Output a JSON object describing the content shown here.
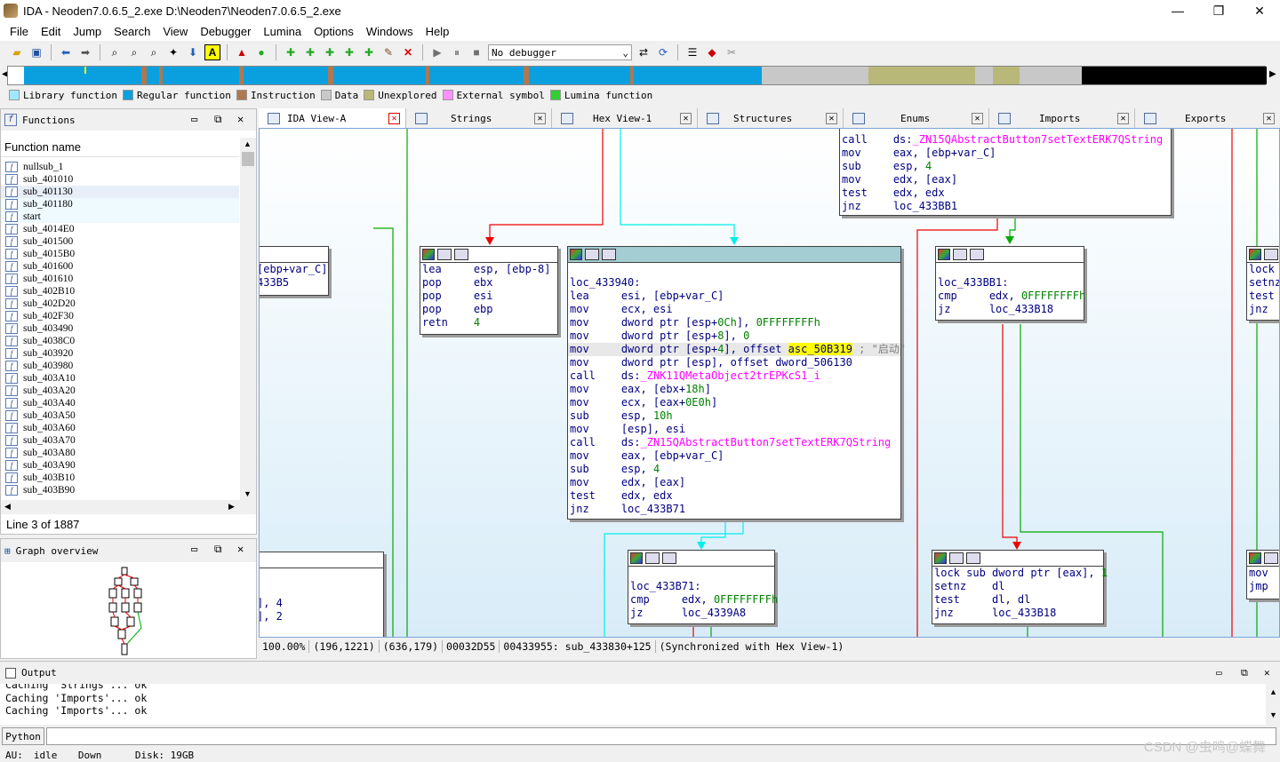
{
  "window": {
    "title": "IDA - Neoden7.0.6.5_2.exe D:\\Neoden7\\Neoden7.0.6.5_2.exe",
    "controls": [
      "—",
      "❐",
      "✕"
    ]
  },
  "menu": [
    "File",
    "Edit",
    "Jump",
    "Search",
    "View",
    "Debugger",
    "Lumina",
    "Options",
    "Windows",
    "Help"
  ],
  "toolbar": {
    "debugger_select": "No debugger"
  },
  "legend": [
    {
      "label": "Library function",
      "color": "#a0e8ff"
    },
    {
      "label": "Regular function",
      "color": "#0aa0e0"
    },
    {
      "label": "Instruction",
      "color": "#b07850"
    },
    {
      "label": "Data",
      "color": "#c8c8c8"
    },
    {
      "label": "Unexplored",
      "color": "#b8b878"
    },
    {
      "label": "External symbol",
      "color": "#ff90ff"
    },
    {
      "label": "Lumina function",
      "color": "#30d030"
    }
  ],
  "functions_panel": {
    "title": "Functions",
    "column": "Function name",
    "items": [
      "nullsub_1",
      "sub_401010",
      "sub_401130",
      "sub_401180",
      "start",
      "sub_4014E0",
      "sub_401500",
      "sub_4015B0",
      "sub_401600",
      "sub_401610",
      "sub_402B10",
      "sub_402D20",
      "sub_402F30",
      "sub_403490",
      "sub_4038C0",
      "sub_403920",
      "sub_403980",
      "sub_403A10",
      "sub_403A20",
      "sub_403A40",
      "sub_403A50",
      "sub_403A60",
      "sub_403A70",
      "sub_403A80",
      "sub_403A90",
      "sub_403B10",
      "sub_403B90"
    ],
    "line_status": "Line 3 of 1887"
  },
  "graph_overview": {
    "title": "Graph overview"
  },
  "tabs": [
    {
      "label": "IDA View-A"
    },
    {
      "label": "Strings"
    },
    {
      "label": "Hex View-1"
    },
    {
      "label": "Structures"
    },
    {
      "label": "Enums"
    },
    {
      "label": "Imports"
    },
    {
      "label": "Exports"
    }
  ],
  "blocks": {
    "top_right": {
      "lines": [
        {
          "m": "call",
          "o": "ds:",
          "s": "_ZN15QAbstractButton7setTextERK7QString"
        },
        {
          "m": "mov",
          "o": "eax, [ebp+var_C]"
        },
        {
          "m": "sub",
          "o": "esp, ",
          "n": "4"
        },
        {
          "m": "mov",
          "o": "edx, [eax]"
        },
        {
          "m": "test",
          "o": "edx, edx"
        },
        {
          "m": "jnz",
          "o": "loc_433BB1"
        }
      ]
    },
    "left_partial": {
      "lines": [
        "[ebp+var_C]",
        "433B5"
      ]
    },
    "epilogue": {
      "lines": [
        {
          "m": "lea",
          "o": "esp, [ebp-8]"
        },
        {
          "m": "pop",
          "o": "ebx"
        },
        {
          "m": "pop",
          "o": "esi"
        },
        {
          "m": "pop",
          "o": "ebp"
        },
        {
          "m": "retn",
          "n": "4"
        }
      ]
    },
    "main": {
      "label": "loc_433940:",
      "lines": [
        {
          "m": "lea",
          "o": "esi, [ebp+var_C]"
        },
        {
          "m": "mov",
          "o": "ecx, esi"
        },
        {
          "m": "mov",
          "o": "dword ptr [esp+",
          "n": "0Ch",
          "o2": "], ",
          "n2": "0FFFFFFFFh"
        },
        {
          "m": "mov",
          "o": "dword ptr [esp+",
          "n": "8",
          "o2": "], ",
          "n2": "0"
        },
        {
          "m": "mov",
          "o": "dword ptr [esp+",
          "n": "4",
          "o2": "], offset ",
          "h": "asc_50B319",
          "c": " ; \"启动\""
        },
        {
          "m": "mov",
          "o": "dword ptr [esp], offset dword_506130"
        },
        {
          "m": "call",
          "o": "ds:",
          "s": "_ZNK11QMetaObject2trEPKcS1_i"
        },
        {
          "m": "mov",
          "o": "eax, [ebx+",
          "n": "18h",
          "o2": "]"
        },
        {
          "m": "mov",
          "o": "ecx, [eax+",
          "n": "0E0h",
          "o2": "]"
        },
        {
          "m": "sub",
          "o": "esp, ",
          "n": "10h"
        },
        {
          "m": "mov",
          "o": "[esp], esi"
        },
        {
          "m": "call",
          "o": "ds:",
          "s": "_ZN15QAbstractButton7setTextERK7QString"
        },
        {
          "m": "mov",
          "o": "eax, [ebp+var_C]"
        },
        {
          "m": "sub",
          "o": "esp, ",
          "n": "4"
        },
        {
          "m": "mov",
          "o": "edx, [eax]"
        },
        {
          "m": "test",
          "o": "edx, edx"
        },
        {
          "m": "jnz",
          "o": "loc_433B71"
        }
      ]
    },
    "bb1": {
      "label": "loc_433BB1:",
      "lines": [
        {
          "m": "cmp",
          "o": "edx, ",
          "n": "0FFFFFFFFh"
        },
        {
          "m": "jz",
          "o": "loc_433B18"
        }
      ]
    },
    "b71": {
      "label": "loc_433B71:",
      "lines": [
        {
          "m": "cmp",
          "o": "edx, ",
          "n": "0FFFFFFFFh"
        },
        {
          "m": "jz",
          "o": "loc_4339A8"
        }
      ]
    },
    "lock": {
      "lines": [
        {
          "m": "lock sub",
          "o": "dword ptr [eax], ",
          "n": "1"
        },
        {
          "m": "setnz",
          "o": "dl"
        },
        {
          "m": "test",
          "o": "dl, dl"
        },
        {
          "m": "jnz",
          "o": "loc_433B18"
        }
      ]
    },
    "right_edge_top": {
      "lines": [
        "lock",
        "setnz",
        "test",
        "jnz"
      ]
    },
    "right_edge_bottom": {
      "lines": [
        "mov",
        "jmp"
      ]
    },
    "left_bottom_partial": {
      "lines": [
        "], 4",
        "], 2"
      ]
    }
  },
  "graph_status": [
    "100.00%",
    "(196,1221)",
    "(636,179)",
    "00032D55",
    "00433955: sub_433830+125",
    "(Synchronized with Hex View-1)"
  ],
  "output": {
    "title": "Output",
    "lines": [
      "Caching 'Strings'... ok",
      "Caching 'Imports'... ok",
      "Caching 'Imports'... ok"
    ],
    "python_label": "Python"
  },
  "statusbar": {
    "au": "AU:",
    "state": "idle",
    "dir": "Down",
    "disk": "Disk: 19GB"
  },
  "watermark": "CSDN @虫鸣@蝶舞"
}
